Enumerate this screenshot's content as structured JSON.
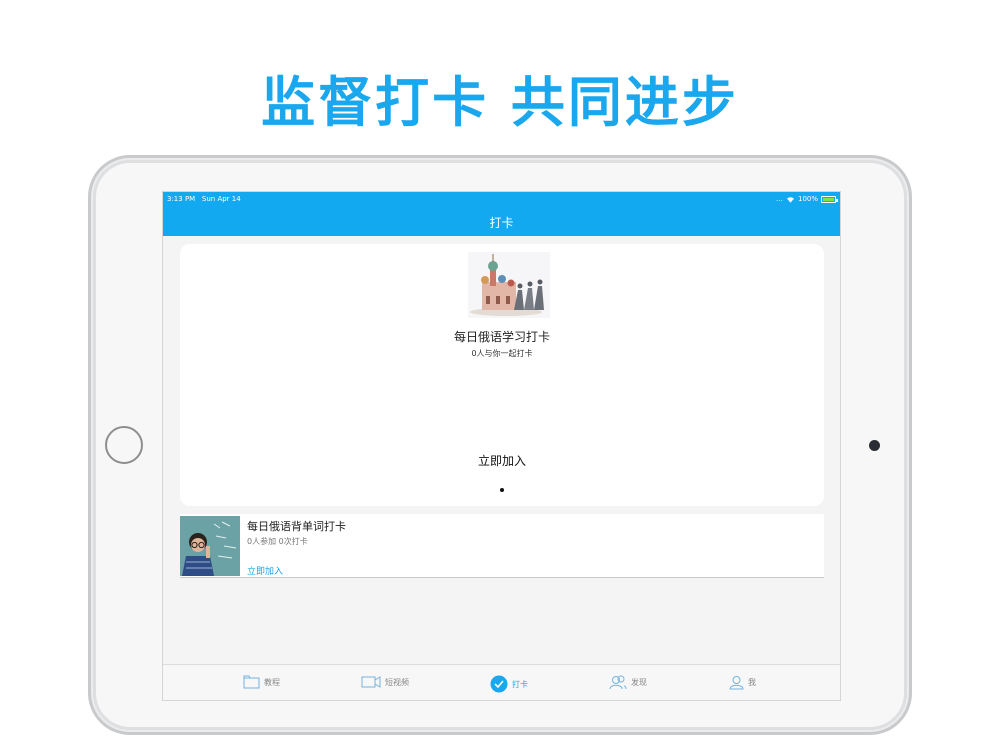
{
  "headline": "监督打卡 共同进步",
  "status_bar": {
    "time": "3:13 PM",
    "date": "Sun Apr 14",
    "battery": "100%"
  },
  "navbar": {
    "title": "打卡"
  },
  "featured": {
    "title": "每日俄语学习打卡",
    "subtitle": "0人与你一起打卡",
    "join_label": "立即加入"
  },
  "items": [
    {
      "title": "每日俄语背单词打卡",
      "stats": "0人参加  0次打卡",
      "join_label": "立即加入"
    }
  ],
  "tabs": [
    {
      "label": "教程",
      "icon": "folder-icon"
    },
    {
      "label": "短视频",
      "icon": "video-camera-icon"
    },
    {
      "label": "打卡",
      "icon": "check-circle-icon",
      "active": true
    },
    {
      "label": "发现",
      "icon": "people-icon"
    },
    {
      "label": "我",
      "icon": "person-icon"
    }
  ],
  "colors": {
    "accent": "#13a9f1",
    "headline": "#1aa7ee",
    "battery": "#7ee34a"
  }
}
